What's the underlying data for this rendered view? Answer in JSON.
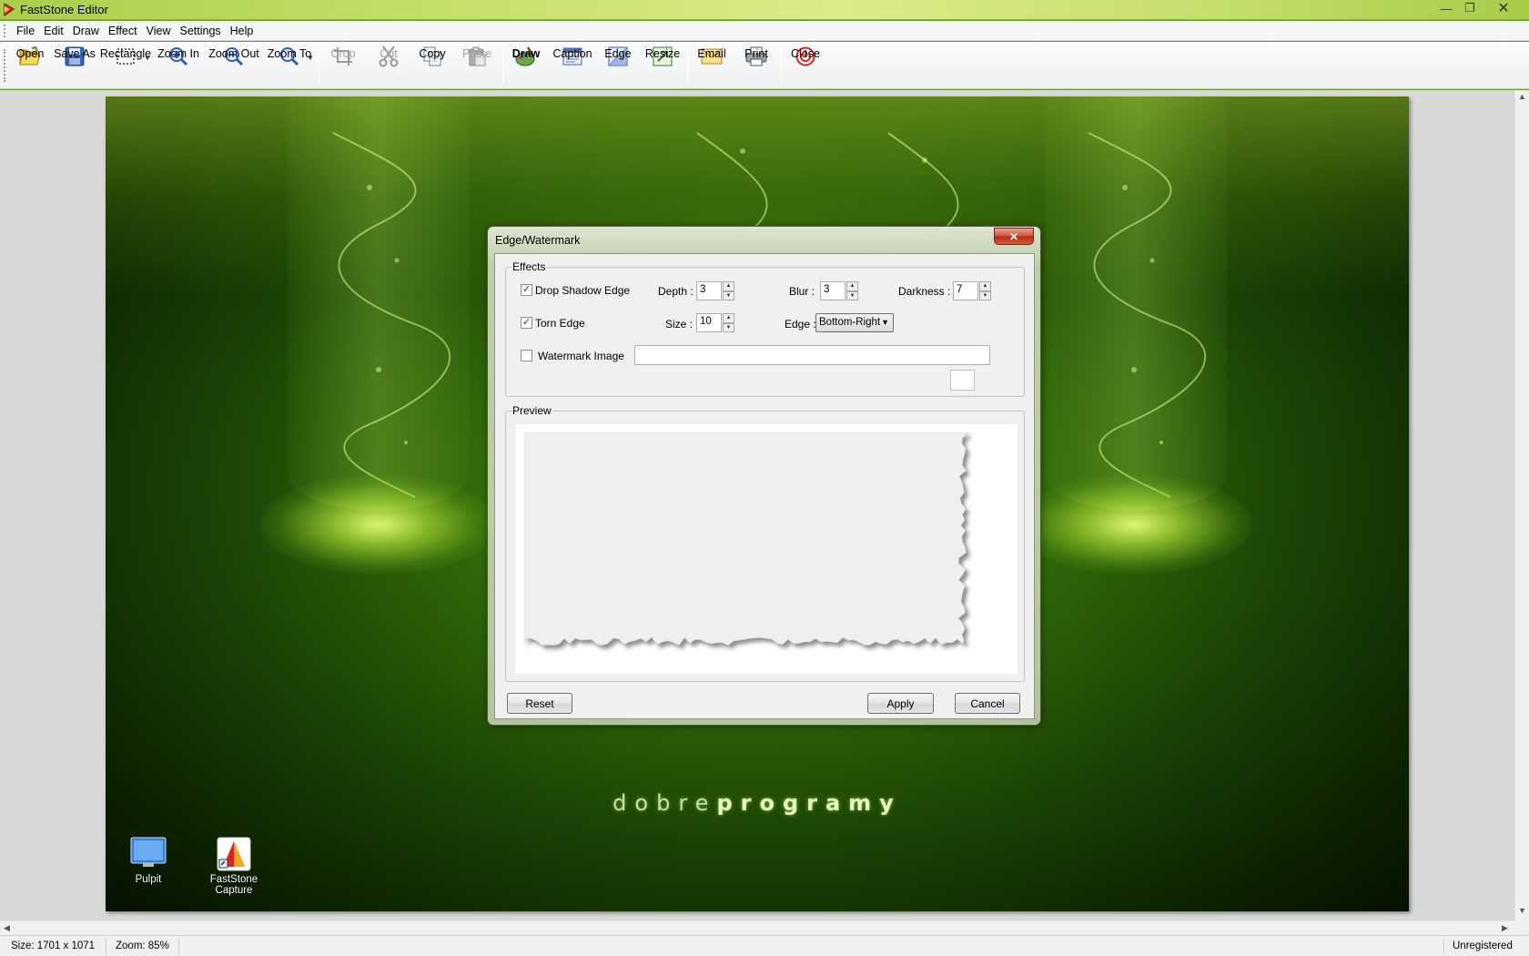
{
  "window": {
    "title": "FastStone Editor"
  },
  "menu": [
    "File",
    "Edit",
    "Draw",
    "Effect",
    "View",
    "Settings",
    "Help"
  ],
  "toolbar": {
    "open": "Open",
    "save_as": "Save As",
    "rectangle": "Rectangle",
    "zoom_in": "Zoom In",
    "zoom_out": "Zoom Out",
    "zoom_to": "Zoom To",
    "crop": "Crop",
    "cut": "Cut",
    "copy": "Copy",
    "paste": "Paste",
    "draw": "Draw",
    "caption": "Caption",
    "edge": "Edge",
    "resize": "Resize",
    "email": "Email",
    "print": "Print",
    "close": "Close"
  },
  "canvas": {
    "brand_light": "dobre",
    "brand_bold": "programy",
    "desktop_icons": [
      "Pulpit",
      "FastStone Capture"
    ]
  },
  "dialog": {
    "title": "Edge/Watermark",
    "effects_legend": "Effects",
    "drop_shadow": {
      "label": "Drop Shadow Edge",
      "checked": true
    },
    "depth": {
      "label": "Depth :",
      "value": "3"
    },
    "blur": {
      "label": "Blur :",
      "value": "3"
    },
    "darkness": {
      "label": "Darkness :",
      "value": "7"
    },
    "torn_edge": {
      "label": "Torn Edge",
      "checked": true
    },
    "size": {
      "label": "Size :",
      "value": "10"
    },
    "edge": {
      "label": "Edge :",
      "value": "Bottom-Right"
    },
    "watermark": {
      "label": "Watermark Image",
      "checked": false,
      "path": ""
    },
    "preview_legend": "Preview",
    "reset": "Reset",
    "apply": "Apply",
    "cancel": "Cancel"
  },
  "status": {
    "size": "Size: 1701 x 1071",
    "zoom": "Zoom: 85%",
    "license": "Unregistered"
  }
}
